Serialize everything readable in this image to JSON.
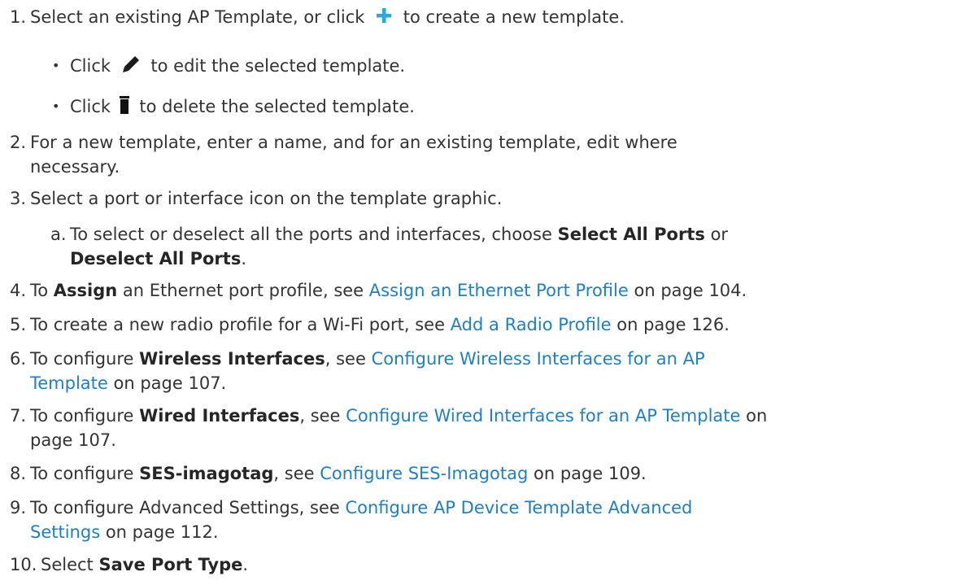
{
  "steps": [
    {
      "num": "1.",
      "text_a": "Select an existing AP Template, or click",
      "add_icon": "plus-icon",
      "text_b": "to create a new template.",
      "bullets": [
        {
          "pre": "Click",
          "icon": "pencil-icon",
          "post": "to edit the selected template."
        },
        {
          "pre": "Click",
          "icon": "trash-icon",
          "post": "to delete the selected template."
        }
      ]
    },
    {
      "num": "2.",
      "line1": "For a new template, enter a name, and for an existing template, edit where",
      "line2": "necessary."
    },
    {
      "num": "3.",
      "text": "Select a port or interface icon on the template graphic.",
      "sub": {
        "letter": "a.",
        "pre": "To select or deselect all the ports and interfaces, choose",
        "bold1": "Select All Ports",
        "mid": "or",
        "bold2": "Deselect All Ports",
        "end": "."
      }
    },
    {
      "num": "4.",
      "pre": "To",
      "bold": "Assign",
      "mid": "an Ethernet port profile, see",
      "link": "Assign an Ethernet Port Profile",
      "post": "on page 104."
    },
    {
      "num": "5.",
      "pre": "To create a new radio profile for a Wi-Fi port, see",
      "link": "Add a Radio Profile",
      "post": "on page 126."
    },
    {
      "num": "6.",
      "pre": "To configure",
      "bold": "Wireless Interfaces",
      "mid": ", see",
      "link1": "Configure Wireless Interfaces for an AP",
      "link2": "Template",
      "post": "on page 107."
    },
    {
      "num": "7.",
      "pre": "To configure",
      "bold": "Wired Interfaces",
      "mid": ", see",
      "link": "Configure Wired Interfaces for an AP Template",
      "post1": "on",
      "post2": "page 107."
    },
    {
      "num": "8.",
      "pre": "To configure",
      "bold": "SES-imagotag",
      "mid": ", see",
      "link": "Configure SES-Imagotag",
      "post": "on page 109."
    },
    {
      "num": "9.",
      "pre": "To configure Advanced Settings, see",
      "link1": "Configure AP Device Template Advanced",
      "link2": "Settings",
      "post": "on page 112."
    },
    {
      "num": "10.",
      "pre": "Select",
      "bold": "Save Port Type",
      "end": "."
    }
  ],
  "colors": {
    "text": "#333333",
    "link": "#1f7fc2",
    "plus_icon": "#29a8e0",
    "pencil_icon": "#1a1a1a",
    "trash_icon": "#111111"
  }
}
